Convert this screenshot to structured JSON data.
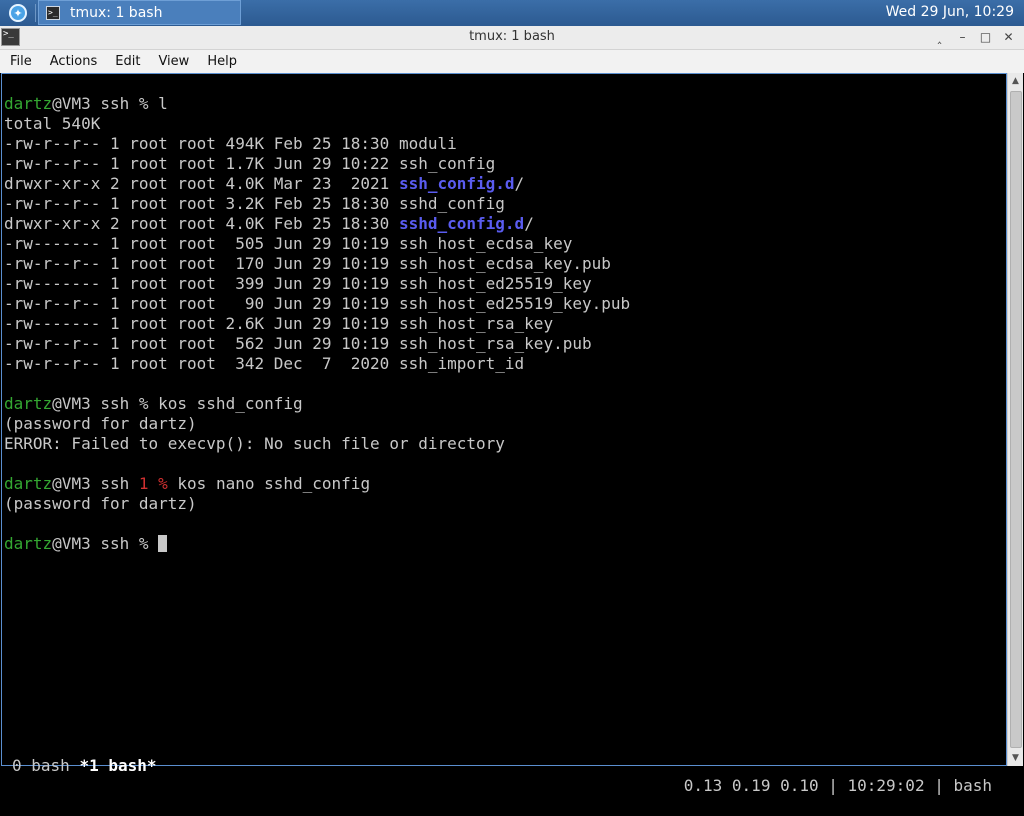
{
  "panel": {
    "task_label": "tmux: 1 bash",
    "clock": "Wed 29 Jun, 10:29"
  },
  "window": {
    "title": "tmux: 1 bash",
    "buttons": [
      "‸",
      "–",
      "□",
      "✕"
    ]
  },
  "menu": [
    "File",
    "Actions",
    "Edit",
    "View",
    "Help"
  ],
  "terminal": {
    "lines": [
      [
        [
          "user",
          "dartz"
        ],
        [
          "",
          "@VM3 ssh % l"
        ]
      ],
      [
        [
          "",
          "total 540K"
        ]
      ],
      [
        [
          "",
          "-rw-r--r-- 1 root root 494K Feb 25 18:30 moduli"
        ]
      ],
      [
        [
          "",
          "-rw-r--r-- 1 root root 1.7K Jun 29 10:22 ssh_config"
        ]
      ],
      [
        [
          "",
          "drwxr-xr-x 2 root root 4.0K Mar 23  2021 "
        ],
        [
          "dir",
          "ssh_config.d"
        ],
        [
          "",
          "/"
        ]
      ],
      [
        [
          "",
          "-rw-r--r-- 1 root root 3.2K Feb 25 18:30 sshd_config"
        ]
      ],
      [
        [
          "",
          "drwxr-xr-x 2 root root 4.0K Feb 25 18:30 "
        ],
        [
          "dir",
          "sshd_config.d"
        ],
        [
          "",
          "/"
        ]
      ],
      [
        [
          "",
          "-rw------- 1 root root  505 Jun 29 10:19 ssh_host_ecdsa_key"
        ]
      ],
      [
        [
          "",
          "-rw-r--r-- 1 root root  170 Jun 29 10:19 ssh_host_ecdsa_key.pub"
        ]
      ],
      [
        [
          "",
          "-rw------- 1 root root  399 Jun 29 10:19 ssh_host_ed25519_key"
        ]
      ],
      [
        [
          "",
          "-rw-r--r-- 1 root root   90 Jun 29 10:19 ssh_host_ed25519_key.pub"
        ]
      ],
      [
        [
          "",
          "-rw------- 1 root root 2.6K Jun 29 10:19 ssh_host_rsa_key"
        ]
      ],
      [
        [
          "",
          "-rw-r--r-- 1 root root  562 Jun 29 10:19 ssh_host_rsa_key.pub"
        ]
      ],
      [
        [
          "",
          "-rw-r--r-- 1 root root  342 Dec  7  2020 ssh_import_id"
        ]
      ],
      [],
      [
        [
          "user",
          "dartz"
        ],
        [
          "",
          "@VM3 ssh % kos sshd_config"
        ]
      ],
      [
        [
          "",
          "(password for dartz)"
        ]
      ],
      [
        [
          "",
          "ERROR: Failed to execvp(): No such file or directory"
        ]
      ],
      [],
      [
        [
          "user",
          "dartz"
        ],
        [
          "",
          "@VM3 ssh "
        ],
        [
          "err",
          "1 %"
        ],
        [
          "",
          " kos nano sshd_config"
        ]
      ],
      [
        [
          "",
          "(password for dartz)"
        ]
      ],
      [],
      [
        [
          "user",
          "dartz"
        ],
        [
          "",
          "@VM3 ssh % "
        ],
        [
          "cursor",
          ""
        ]
      ]
    ],
    "status_left_a": "0 bash ",
    "status_left_b": "*1 bash*",
    "status_right": "0.13 0.19 0.10 | 10:29:02 | bash"
  }
}
